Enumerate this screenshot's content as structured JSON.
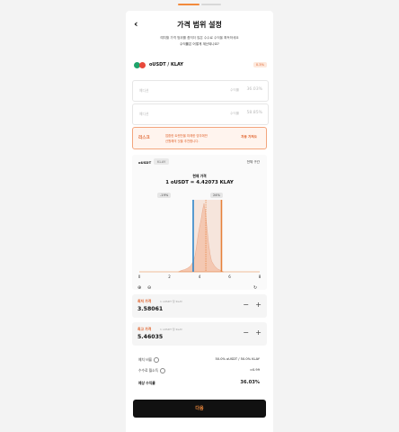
{
  "header": {
    "back_glyph": "‹",
    "title": "가격 범위 설정",
    "desc_line1": "예치할 가격 범위를 좁히더 많은 수수료 수익을 획득하세요",
    "desc_line2": "수익률은 어떻게 계산되나요?"
  },
  "pair": {
    "name": "oUSDT / KLAY",
    "fee": "0.3%",
    "token_colors": [
      "#1fa36b",
      "#e8483b"
    ]
  },
  "inputs": [
    {
      "label": "예디션",
      "unit": "수익률",
      "pct": "36.03%"
    },
    {
      "label": "예디션",
      "unit": "수익률",
      "pct": "58.85%"
    }
  ],
  "warning": {
    "title": "리스크",
    "line1": "업환한 트랜잔을 미래한 영무에만",
    "line2": "산원해의 것을 추천합니다.",
    "button": "자동 가져오"
  },
  "chart_panel": {
    "token_a": "oUSDT",
    "token_b": "KLAY",
    "full_range": "전체 구간",
    "current_label": "현재 가격",
    "current_value": "1 oUSDT = 4.42073 KLAY",
    "chip_left": "-19%",
    "chip_right": "24%",
    "zoom_in": "⊕",
    "zoom_out": "⊖",
    "reset": "↻"
  },
  "chart_data": {
    "type": "area",
    "x": [
      2.6,
      2.8,
      3.0,
      3.2,
      3.4,
      3.6,
      3.7,
      3.8,
      3.9,
      4.0,
      4.1,
      4.2,
      4.3,
      4.4,
      4.5,
      4.6,
      4.7,
      4.8,
      5.0,
      5.2,
      5.4,
      5.6
    ],
    "series": [
      {
        "values": [
          0.0,
          0.02,
          0.03,
          0.05,
          0.08,
          0.15,
          0.22,
          0.35,
          0.5,
          0.62,
          0.72,
          0.85,
          0.95,
          0.82,
          0.6,
          0.4,
          0.25,
          0.15,
          0.08,
          0.04,
          0.02,
          0.0
        ]
      }
    ],
    "xlim": [
      0,
      8
    ],
    "xticks": [
      "0",
      "2",
      "4",
      "6",
      "8"
    ],
    "ylim": [
      0,
      1
    ],
    "current_price": 4.42073,
    "min_price": 3.58061,
    "max_price": 5.46035,
    "colors": {
      "min": "#2f86c9",
      "current": "#e6813a",
      "max": "#e6813a",
      "fill": "#f4c8b2",
      "band": "#f6e5dc"
    }
  },
  "min_box": {
    "label": "최저 가격",
    "sub": "1 oUSDT 당 KLAY",
    "value": "3.58061",
    "minus": "−",
    "plus": "+"
  },
  "max_box": {
    "label": "최고 가격",
    "sub": "1 oUSDT 당 KLAY",
    "value": "5.46035",
    "minus": "−",
    "plus": "+"
  },
  "summary": [
    {
      "key": "예치 비율",
      "value": "50.0% oUSDT / 50.0% KLAY"
    },
    {
      "key": "수수료 월소득",
      "value": "≈0.99"
    },
    {
      "key": "예상 수익률",
      "value": "36.03%"
    }
  ],
  "next_button": "다음"
}
